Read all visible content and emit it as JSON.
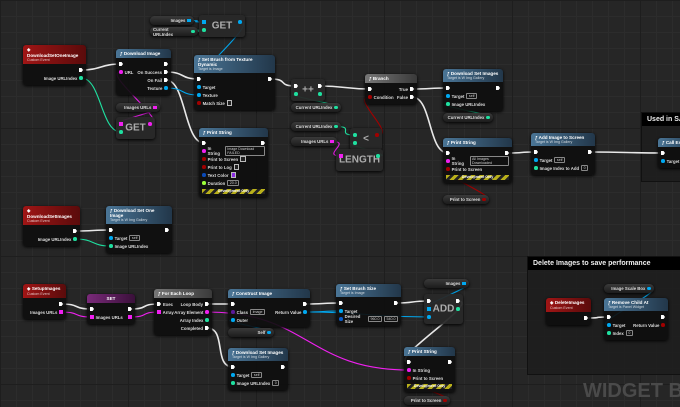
{
  "pin_colors": {
    "exec": "#ffffff",
    "int": "#1fe0a0",
    "obj": "#00a8f0",
    "bool": "#a00000",
    "str": "#f020f0",
    "cls": "#5a1a9a",
    "struct": "#0a5ac8",
    "color": "#0a4ab8",
    "float": "#9cff3a"
  },
  "watermark": "WIDGET BLU",
  "comments": [
    {
      "id": "c1",
      "title": "Used in SA"
    },
    {
      "id": "c2",
      "title": "Delete Images to save performance"
    }
  ],
  "nodes": [
    {
      "id": "ev_dsoi",
      "kind": "event",
      "title": "DownloadSetOneImage",
      "subtitle": "Custom Event",
      "rows": [
        [
          null,
          {
            "t": "exec"
          }
        ],
        [
          null,
          {
            "label": "Image URLIndex",
            "t": "int"
          }
        ]
      ]
    },
    {
      "id": "vimg1",
      "kind": "var",
      "label": "Images",
      "t": "obj",
      "arr": true
    },
    {
      "id": "vcur1",
      "kind": "var",
      "label": "Current URLIndex",
      "t": "int"
    },
    {
      "id": "get1",
      "kind": "compact",
      "title": "GET",
      "rows": [
        [
          {
            "t": "obj",
            "arr": true
          },
          {
            "t": "obj"
          }
        ],
        [
          {
            "t": "int"
          },
          null
        ]
      ]
    },
    {
      "id": "dl",
      "kind": "func",
      "title": "Download Image",
      "rows": [
        [
          {
            "t": "exec"
          },
          {
            "t": "exec"
          }
        ],
        [
          {
            "label": "URL",
            "t": "str"
          },
          {
            "label": "On Success",
            "t": "exec"
          }
        ],
        [
          null,
          {
            "label": "On Fail",
            "t": "exec"
          }
        ],
        [
          null,
          {
            "label": "Texture",
            "t": "obj"
          }
        ]
      ]
    },
    {
      "id": "vurls1",
      "kind": "var",
      "label": "Images URLs",
      "t": "str",
      "arr": true
    },
    {
      "id": "get2",
      "kind": "compact",
      "title": "GET",
      "rows": [
        [
          {
            "t": "str",
            "arr": true
          },
          {
            "t": "str"
          }
        ],
        [
          {
            "t": "int"
          },
          null
        ]
      ]
    },
    {
      "id": "sb",
      "kind": "func",
      "title": "Set Brush from Texture Dynamic",
      "subtitle": "Target is Image",
      "rows": [
        [
          {
            "t": "exec"
          },
          {
            "t": "exec"
          }
        ],
        [
          {
            "label": "Target",
            "t": "obj"
          },
          null
        ],
        [
          {
            "label": "Texture",
            "t": "obj"
          },
          null
        ],
        [
          {
            "label": "Match Size",
            "t": "bool",
            "check": true
          },
          null
        ]
      ]
    },
    {
      "id": "ps1",
      "kind": "func",
      "title": "Print String",
      "rows": [
        [
          {
            "t": "exec"
          },
          {
            "t": "exec"
          }
        ],
        [
          {
            "label": "In String",
            "t": "str",
            "value": "Image Download FAILED"
          },
          null
        ],
        [
          {
            "label": "Print to Screen",
            "t": "bool",
            "check": true
          },
          null
        ],
        [
          {
            "label": "Print to Log",
            "t": "bool",
            "check": true
          },
          null
        ],
        [
          {
            "label": "Text Color",
            "t": "color",
            "swatch": "#8a2be2"
          },
          null
        ],
        [
          {
            "label": "Duration",
            "t": "float",
            "value": "20.0"
          },
          null
        ]
      ],
      "dev": "Development Only"
    },
    {
      "id": "inc",
      "kind": "compact",
      "title": "++",
      "rows": [
        [
          {
            "t": "exec"
          },
          {
            "t": "exec"
          }
        ],
        [
          {
            "t": "int"
          },
          {
            "t": "int"
          }
        ]
      ]
    },
    {
      "id": "vcur2",
      "kind": "var",
      "label": "Current URLIndex",
      "t": "int"
    },
    {
      "id": "vcur3",
      "kind": "var",
      "label": "Current URLIndex",
      "t": "int"
    },
    {
      "id": "vurls2",
      "kind": "var",
      "label": "Images URLs",
      "t": "str",
      "arr": true
    },
    {
      "id": "less",
      "kind": "compact",
      "title": "<",
      "rows": [
        [
          {
            "t": "int"
          },
          {
            "t": "bool"
          }
        ],
        [
          {
            "t": "int"
          },
          null
        ]
      ]
    },
    {
      "id": "len",
      "kind": "compact",
      "title": "LENGTH",
      "rows": [
        [
          {
            "t": "str",
            "arr": true
          },
          {
            "t": "int"
          }
        ],
        [
          null,
          null
        ]
      ]
    },
    {
      "id": "br",
      "kind": "macro",
      "title": "Branch",
      "rows": [
        [
          {
            "t": "exec"
          },
          {
            "label": "True",
            "t": "exec"
          }
        ],
        [
          {
            "label": "Condition",
            "t": "bool"
          },
          {
            "label": "False",
            "t": "exec"
          }
        ]
      ]
    },
    {
      "id": "dsi1",
      "kind": "func",
      "title": "Download Set Images",
      "subtitle": "Target is W Img Gallery",
      "rows": [
        [
          {
            "t": "exec"
          },
          {
            "t": "exec"
          }
        ],
        [
          {
            "label": "Target",
            "t": "obj",
            "value": "self"
          },
          null
        ],
        [
          {
            "label": "Image URLIndex",
            "t": "int"
          },
          null
        ]
      ]
    },
    {
      "id": "vcur4",
      "kind": "var",
      "label": "Current URLIndex",
      "t": "int"
    },
    {
      "id": "ps2",
      "kind": "func",
      "title": "Print String",
      "rows": [
        [
          {
            "t": "exec"
          },
          {
            "t": "exec"
          }
        ],
        [
          {
            "label": "In String",
            "t": "str",
            "value": "All Images Downloaded"
          },
          null
        ],
        [
          {
            "label": "Print to Screen",
            "t": "bool"
          },
          null
        ]
      ],
      "dev": "Development Only"
    },
    {
      "id": "vpts1",
      "kind": "var",
      "label": "Print to Screen",
      "t": "bool"
    },
    {
      "id": "add",
      "kind": "func",
      "title": "Add Image to Screen",
      "subtitle": "Target is W Img Gallery",
      "rows": [
        [
          {
            "t": "exec"
          },
          {
            "t": "exec"
          }
        ],
        [
          {
            "label": "Target",
            "t": "obj",
            "value": "self"
          },
          null
        ],
        [
          {
            "label": "Image Index to Add",
            "t": "int",
            "value": "0"
          },
          null
        ]
      ]
    },
    {
      "id": "call",
      "kind": "func",
      "title": "Call EA",
      "rows": [
        [
          {
            "t": "exec"
          },
          null
        ],
        [
          {
            "label": "Target",
            "t": "obj"
          },
          null
        ]
      ]
    },
    {
      "id": "ev_dsi",
      "kind": "event",
      "title": "DownloadSetImages",
      "subtitle": "Custom Event",
      "rows": [
        [
          null,
          {
            "t": "exec"
          }
        ],
        [
          null,
          {
            "label": "Image URLIndex",
            "t": "int"
          }
        ]
      ]
    },
    {
      "id": "dsoi",
      "kind": "func",
      "title": "Download Set One Image",
      "subtitle": "Target is W Img Gallery",
      "rows": [
        [
          {
            "t": "exec"
          },
          {
            "t": "exec"
          }
        ],
        [
          {
            "label": "Target",
            "t": "obj",
            "value": "self"
          },
          null
        ],
        [
          {
            "label": "Image URLIndex",
            "t": "int"
          },
          null
        ]
      ]
    },
    {
      "id": "ev_setup",
      "kind": "event",
      "title": "SetupImages",
      "subtitle": "Custom Event",
      "rows": [
        [
          null,
          {
            "t": "exec"
          }
        ],
        [
          null,
          {
            "label": "Images URLs",
            "t": "str",
            "arr": true
          }
        ]
      ]
    },
    {
      "id": "set",
      "kind": "setn",
      "title": "SET",
      "rows": [
        [
          {
            "t": "exec"
          },
          {
            "t": "exec"
          }
        ],
        [
          {
            "label": "Images URLs",
            "t": "str",
            "arr": true
          },
          {
            "t": "str",
            "arr": true
          }
        ]
      ]
    },
    {
      "id": "fe",
      "kind": "macro",
      "title": "For Each Loop",
      "rows": [
        [
          {
            "label": "Exec",
            "t": "exec"
          },
          {
            "label": "Loop Body",
            "t": "exec"
          }
        ],
        [
          {
            "label": "Array",
            "t": "str",
            "arr": true
          },
          {
            "label": "Array Element",
            "t": "str"
          }
        ],
        [
          null,
          {
            "label": "Array Index",
            "t": "int"
          }
        ],
        [
          null,
          {
            "label": "Completed",
            "t": "exec"
          }
        ]
      ]
    },
    {
      "id": "ci",
      "kind": "func",
      "title": "Construct Image",
      "rows": [
        [
          {
            "t": "exec"
          },
          {
            "t": "exec"
          }
        ],
        [
          {
            "label": "Class",
            "t": "cls",
            "value": "Image"
          },
          {
            "label": "Return Value",
            "t": "obj"
          }
        ],
        [
          {
            "label": "Outer",
            "t": "obj"
          },
          null
        ]
      ]
    },
    {
      "id": "vself",
      "kind": "var",
      "label": "Self",
      "t": "obj"
    },
    {
      "id": "dsi2",
      "kind": "func",
      "title": "Download Set Images",
      "subtitle": "Target is W Img Gallery",
      "rows": [
        [
          {
            "t": "exec"
          },
          {
            "t": "exec"
          }
        ],
        [
          {
            "label": "Target",
            "t": "obj",
            "value": "self"
          },
          null
        ],
        [
          {
            "label": "Image URLIndex",
            "t": "int",
            "value": "0"
          },
          null
        ]
      ]
    },
    {
      "id": "sbs",
      "kind": "func",
      "title": "Set Brush Size",
      "subtitle": "Target is Image",
      "rows": [
        [
          {
            "t": "exec"
          },
          {
            "t": "exec"
          }
        ],
        [
          {
            "label": "Target",
            "t": "obj"
          },
          null
        ],
        [
          {
            "label": "Desired Size",
            "t": "struct",
            "value": "960.0",
            "value2": "540.0"
          },
          null
        ]
      ]
    },
    {
      "id": "vimg2",
      "kind": "var",
      "label": "Images",
      "t": "obj",
      "arr": true
    },
    {
      "id": "add2",
      "kind": "compact",
      "title": "ADD",
      "rows": [
        [
          {
            "t": "exec"
          },
          {
            "t": "exec"
          }
        ],
        [
          {
            "t": "obj",
            "arr": true
          },
          {
            "t": "int"
          }
        ],
        [
          {
            "t": "obj"
          },
          null
        ]
      ]
    },
    {
      "id": "ps3",
      "kind": "func",
      "title": "Print String",
      "rows": [
        [
          {
            "t": "exec"
          },
          {
            "t": "exec"
          }
        ],
        [
          {
            "label": "In String",
            "t": "str"
          },
          null
        ],
        [
          {
            "label": "Print to Screen",
            "t": "bool"
          },
          null
        ]
      ],
      "dev": "Development Only"
    },
    {
      "id": "vpts2",
      "kind": "var",
      "label": "Print to Screen",
      "t": "bool"
    },
    {
      "id": "del",
      "kind": "event",
      "title": "DeleteImages",
      "subtitle": "Custom Event",
      "rows": [
        [
          null,
          {
            "t": "exec"
          }
        ]
      ]
    },
    {
      "id": "vsb",
      "kind": "var",
      "label": "Image Scale Box",
      "t": "obj"
    },
    {
      "id": "rca",
      "kind": "func",
      "title": "Remove Child At",
      "subtitle": "Target is Panel Widget",
      "rows": [
        [
          {
            "t": "exec"
          },
          {
            "t": "exec"
          }
        ],
        [
          {
            "label": "Target",
            "t": "obj"
          },
          {
            "label": "Return Value",
            "t": "bool"
          }
        ],
        [
          {
            "label": "Index",
            "t": "int",
            "value": "0"
          },
          null
        ]
      ]
    }
  ],
  "wires": [
    [
      "ev_dsoi.0.r",
      "dl.0.l"
    ],
    [
      "dl.1.r",
      "sb.0.l"
    ],
    [
      "dl.2.r",
      "ps1.0.l"
    ],
    [
      "sb.0.r",
      "inc.0.l"
    ],
    [
      "inc.0.r",
      "br.0.l"
    ],
    [
      "br.0.r",
      "dsi1.0.l"
    ],
    [
      "br.1.r",
      "ps2.0.l"
    ],
    [
      "ps2.0.r",
      "add.0.l"
    ],
    [
      "add.0.r",
      "call.0.l"
    ],
    [
      "ev_dsoi.1.r",
      "get2.1.l"
    ],
    [
      "vurls1.0.r",
      "get2.0.l"
    ],
    [
      "get2.0.r",
      "dl.1.l"
    ],
    [
      "vimg1.0.r",
      "get1.0.l"
    ],
    [
      "vcur1.0.r",
      "get1.1.l"
    ],
    [
      "get1.0.r",
      "sb.1.l"
    ],
    [
      "dl.3.r",
      "sb.2.l"
    ],
    [
      "vcur2.0.r",
      "inc.1.l"
    ],
    [
      "vcur3.0.r",
      "less.0.l"
    ],
    [
      "vurls2.0.r",
      "len.0.l"
    ],
    [
      "len.0.r",
      "less.1.l"
    ],
    [
      "less.0.r",
      "br.1.l"
    ],
    [
      "vcur4.0.r",
      "dsi1.2.l"
    ],
    [
      "vpts1.0.r",
      "ps2.2.l"
    ],
    [
      "ev_dsi.0.r",
      "dsoi.0.l"
    ],
    [
      "ev_dsi.1.r",
      "dsoi.2.l"
    ],
    [
      "ev_setup.0.r",
      "set.0.l"
    ],
    [
      "ev_setup.1.r",
      "set.1.l"
    ],
    [
      "set.0.r",
      "fe.0.l"
    ],
    [
      "set.1.r",
      "fe.1.l"
    ],
    [
      "fe.0.r",
      "ci.0.l"
    ],
    [
      "fe.3.r",
      "dsi2.0.l"
    ],
    [
      "ci.0.r",
      "sbs.0.l"
    ],
    [
      "ci.1.r",
      "sbs.1.l"
    ],
    [
      "vself.0.r",
      "ci.2.l"
    ],
    [
      "sbs.0.r",
      "add2.0.l"
    ],
    [
      "vimg2.0.r",
      "add2.1.l"
    ],
    [
      "ci.1.r",
      "add2.2.l"
    ],
    [
      "add2.0.r",
      "ps3.0.l"
    ],
    [
      "fe.1.r",
      "ps3.1.l"
    ],
    [
      "vpts2.0.r",
      "ps3.2.l"
    ],
    [
      "del.0.r",
      "rca.0.l"
    ],
    [
      "vsb.0.r",
      "rca.1.l"
    ]
  ]
}
